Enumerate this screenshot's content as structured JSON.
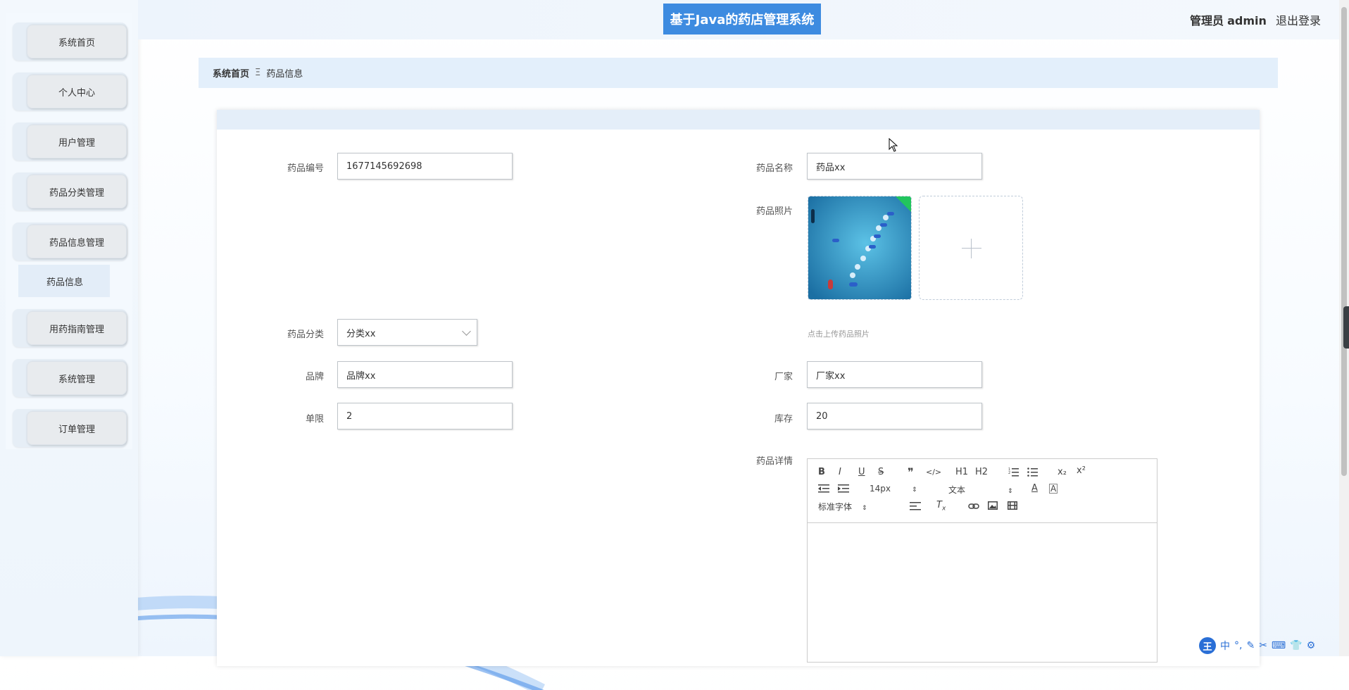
{
  "header": {
    "title": "基于Java的药店管理系统",
    "user_role": "管理员",
    "username": "admin",
    "logout": "退出登录"
  },
  "sidebar": {
    "items": [
      {
        "label": "系统首页"
      },
      {
        "label": "个人中心"
      },
      {
        "label": "用户管理"
      },
      {
        "label": "药品分类管理"
      },
      {
        "label": "药品信息管理"
      },
      {
        "label": "用药指南管理"
      },
      {
        "label": "系统管理"
      },
      {
        "label": "订单管理"
      }
    ],
    "submenu": {
      "label": "药品信息"
    }
  },
  "breadcrumb": {
    "home": "系统首页",
    "separator": "Ξ",
    "current": "药品信息"
  },
  "form": {
    "code": {
      "label": "药品编号",
      "value": "1677145692698"
    },
    "name": {
      "label": "药品名称",
      "value": "药品xx"
    },
    "photo": {
      "label": "药品照片",
      "hint": "点击上传药品照片"
    },
    "category": {
      "label": "药品分类",
      "value": "分类xx"
    },
    "brand": {
      "label": "品牌",
      "value": "品牌xx"
    },
    "maker": {
      "label": "厂家",
      "value": "厂家xx"
    },
    "limit": {
      "label": "单限",
      "value": "2"
    },
    "stock": {
      "label": "库存",
      "value": "20"
    },
    "detail": {
      "label": "药品详情"
    }
  },
  "editor": {
    "bold": "B",
    "italic": "I",
    "underline": "U",
    "strike": "S",
    "quote": "❞",
    "code": "</>",
    "h1": "H1",
    "h2": "H2",
    "subscript": "x₂",
    "superscript": "x²",
    "size_value": "14px",
    "header_value": "文本",
    "font_value": "标准字体"
  },
  "ime": {
    "logo": "王",
    "mode": "中"
  },
  "colors": {
    "title_bg": "#3d8be0",
    "breadcrumb_bg": "#e3effb",
    "card_head": "#e4eef9"
  }
}
